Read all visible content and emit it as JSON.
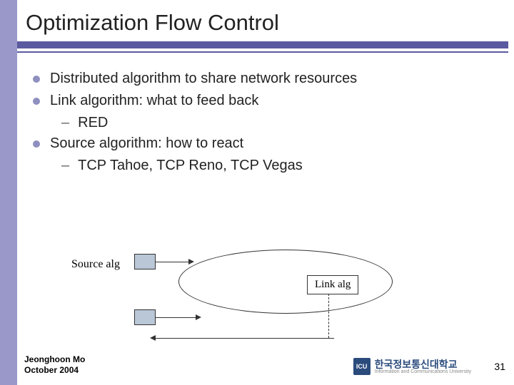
{
  "title": "Optimization Flow Control",
  "bullets": [
    {
      "text": "Distributed algorithm to share network resources"
    },
    {
      "text": "Link algorithm: what to feed back",
      "sub": [
        "RED"
      ]
    },
    {
      "text": "Source algorithm: how to react",
      "sub": [
        "TCP Tahoe, TCP Reno, TCP Vegas"
      ]
    }
  ],
  "diagram": {
    "source_label": "Source alg",
    "link_label": "Link alg"
  },
  "footer": {
    "author": "Jeonghoon Mo",
    "date": "October 2004",
    "logo_mark": "ICU",
    "logo_text": "한국정보통신대학교",
    "logo_sub": "Information and Communications University"
  },
  "page_number": "31"
}
